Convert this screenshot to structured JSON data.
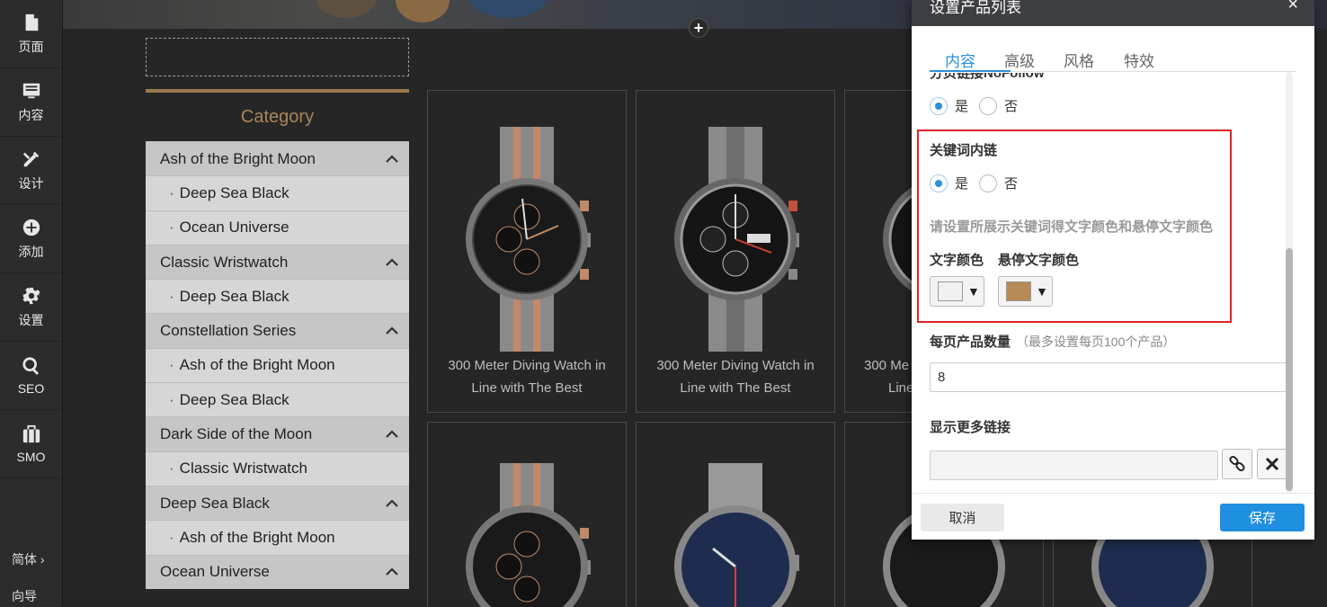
{
  "rail": {
    "items": [
      {
        "label": "页面",
        "icon": "page-icon"
      },
      {
        "label": "内容",
        "icon": "content-icon"
      },
      {
        "label": "设计",
        "icon": "design-icon"
      },
      {
        "label": "添加",
        "icon": "add-icon"
      },
      {
        "label": "设置",
        "icon": "gear-icon"
      },
      {
        "label": "SEO",
        "icon": "search-icon"
      },
      {
        "label": "SMO",
        "icon": "briefcase-icon"
      }
    ],
    "language": "简体 ›",
    "guide": "向导"
  },
  "category": {
    "title": "Category",
    "rows": [
      {
        "label": "Ash of the Bright Moon",
        "type": "parent"
      },
      {
        "label": "Deep Sea Black",
        "type": "child"
      },
      {
        "label": "Ocean Universe",
        "type": "child"
      },
      {
        "label": "Classic Wristwatch",
        "type": "parent"
      },
      {
        "label": "Deep Sea Black",
        "type": "child"
      },
      {
        "label": "Constellation Series",
        "type": "parent"
      },
      {
        "label": "Ash of the Bright Moon",
        "type": "child"
      },
      {
        "label": "Deep Sea Black",
        "type": "child"
      },
      {
        "label": "Dark Side of the Moon",
        "type": "parent"
      },
      {
        "label": "Classic Wristwatch",
        "type": "child"
      },
      {
        "label": "Deep Sea Black",
        "type": "parent"
      },
      {
        "label": "Ash of the Bright Moon",
        "type": "child"
      },
      {
        "label": "Ocean Universe",
        "type": "parent"
      }
    ]
  },
  "products": [
    {
      "title_line1": "300 Meter Diving Watch in",
      "title_line2": "Line with The Best",
      "face": "black-rose"
    },
    {
      "title_line1": "300 Meter Diving Watch in",
      "title_line2": "Line with The Best",
      "face": "black-steel"
    },
    {
      "title_line1": "300 Me",
      "title_line2": "Line",
      "face": "black-steel"
    }
  ],
  "modal": {
    "title": "设置产品列表",
    "close": "×",
    "tabs": [
      "内容",
      "高级",
      "风格",
      "特效"
    ],
    "cut_label": "分页链接NoFollow",
    "nofollow": {
      "yes": "是",
      "no": "否",
      "selected": "yes"
    },
    "keyword_link": {
      "title": "关键词内链",
      "yes": "是",
      "no": "否",
      "selected": "yes",
      "hint": "请设置所展示关键词得文字颜色和悬停文字颜色",
      "text_color_label": "文字颜色",
      "hover_color_label": "悬停文字颜色",
      "text_color": "#f0f0f0",
      "hover_color": "#b88a55"
    },
    "per_page": {
      "label": "每页产品数量",
      "note": "（最多设置每页100个产品）",
      "value": "8"
    },
    "more_link": {
      "label": "显示更多链接",
      "value": ""
    },
    "cancel": "取消",
    "save": "保存"
  },
  "colors": {
    "accent": "#2a90d9",
    "highlight": "#e02222",
    "brand_gold": "#a98659"
  }
}
